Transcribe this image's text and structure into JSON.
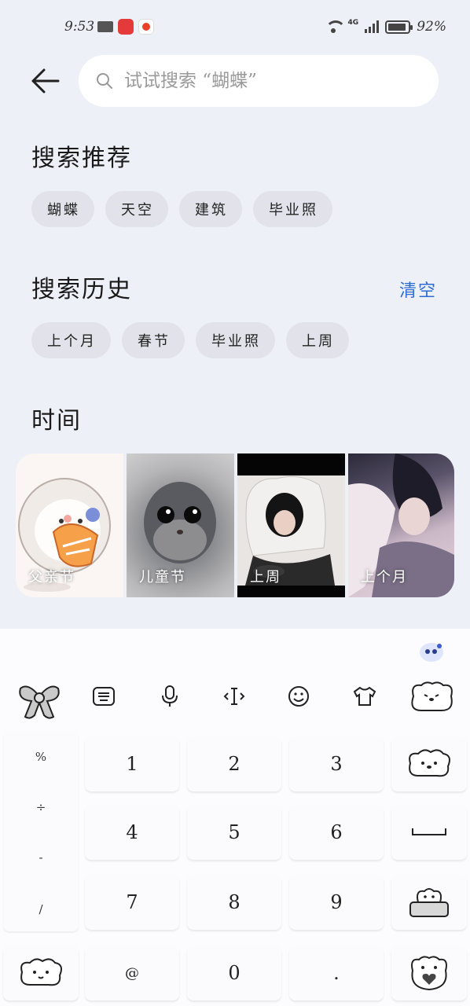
{
  "status_bar": {
    "time": "9:53",
    "network": "4G",
    "battery_percent": "92%",
    "battery_level": 0.92
  },
  "search": {
    "placeholder": "试试搜索 “蝴蝶”"
  },
  "recommend": {
    "title": "搜索推荐",
    "chips": [
      "蝴蝶",
      "天空",
      "建筑",
      "毕业照"
    ]
  },
  "history": {
    "title": "搜索历史",
    "clear_label": "清空",
    "chips": [
      "上个月",
      "春节",
      "毕业照",
      "上周"
    ]
  },
  "time_section": {
    "title": "时间",
    "photos": [
      "父亲节",
      "儿童节",
      "上周",
      "上个月"
    ]
  },
  "keyboard": {
    "symbols": [
      "%",
      "÷",
      "-",
      "/"
    ],
    "digits": [
      "1",
      "2",
      "3",
      "4",
      "5",
      "6",
      "7",
      "8",
      "9",
      "@",
      "0",
      "."
    ]
  },
  "colors": {
    "accent": "#2d6bd2",
    "background": "#eef0f8"
  }
}
